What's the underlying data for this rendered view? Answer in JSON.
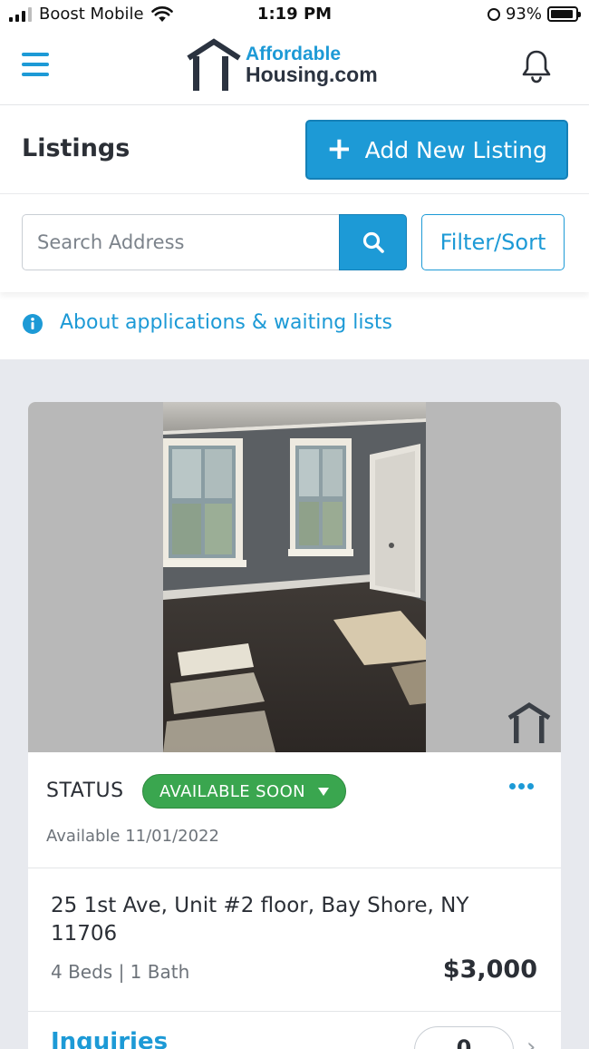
{
  "status_bar": {
    "carrier": "Boost Mobile",
    "time": "1:19 PM",
    "battery_pct": "93%",
    "battery_level": 0.93
  },
  "header": {
    "logo_top": "Affordable",
    "logo_bottom": "Housing.com",
    "menu_icon": "hamburger-icon",
    "notification_icon": "bell-icon"
  },
  "listings": {
    "title": "Listings",
    "add_button_label": "Add New Listing"
  },
  "search": {
    "placeholder": "Search Address",
    "filter_label": "Filter/Sort"
  },
  "info_link": "About applications & waiting lists",
  "listing_card": {
    "status_label": "STATUS",
    "status_value": "AVAILABLE SOON",
    "available": "Available 11/01/2022",
    "address": "25 1st Ave, Unit #2 floor, Bay Shore, NY 11706",
    "beds_baths": "4 Beds | 1 Bath",
    "price": "$3,000",
    "inquiries_label": "Inquiries",
    "inquiries_count": "0"
  },
  "colors": {
    "brand_blue": "#1d9ad6",
    "status_green": "#3aa64f",
    "dark_text": "#2b2f36",
    "background_gray": "#e7e9ee"
  }
}
